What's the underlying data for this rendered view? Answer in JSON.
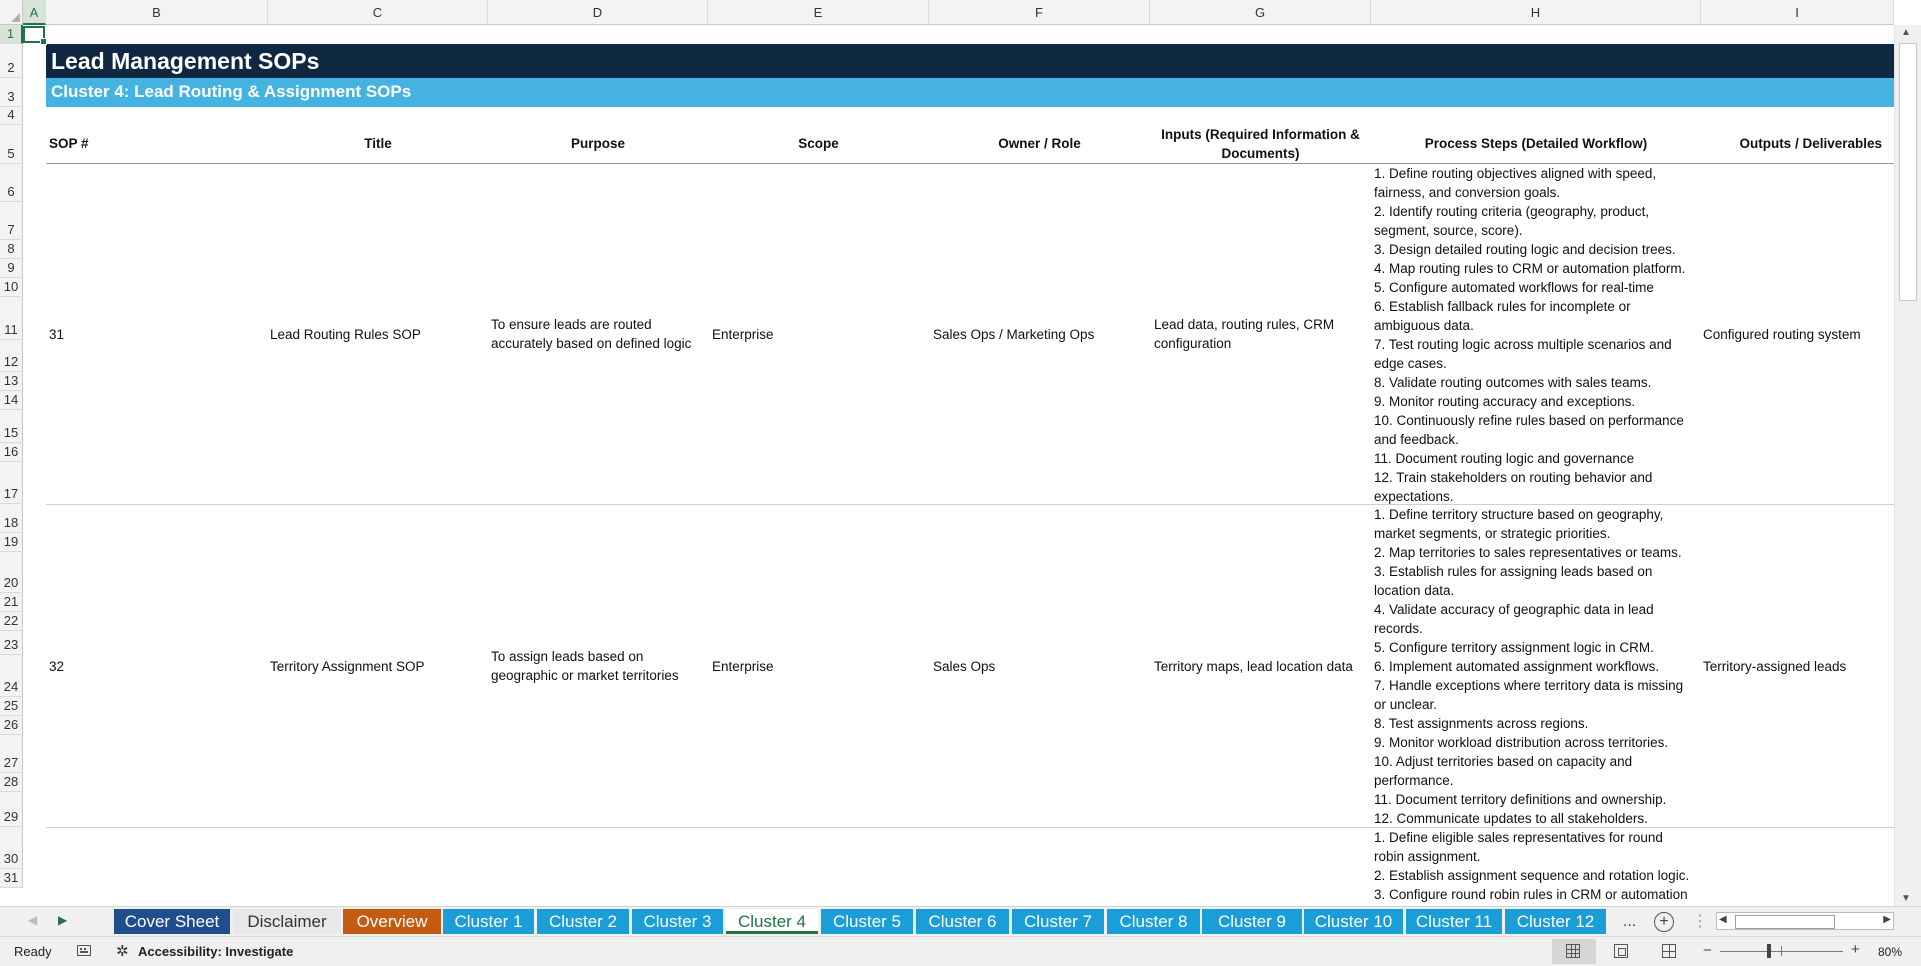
{
  "columns": [
    "A",
    "B",
    "C",
    "D",
    "E",
    "F",
    "G",
    "H",
    "I"
  ],
  "rows": [
    "1",
    "2",
    "3",
    "4",
    "5",
    "6",
    "7",
    "8",
    "9",
    "10",
    "11",
    "12",
    "13",
    "14",
    "15",
    "16",
    "17",
    "18",
    "19",
    "20",
    "21",
    "22",
    "23",
    "24",
    "25",
    "26",
    "27",
    "28",
    "29",
    "30",
    "31"
  ],
  "sheet": {
    "title": "Lead Management SOPs",
    "cluster_title": "Cluster 4: Lead Routing & Assignment SOPs",
    "headers": {
      "sop": "SOP #",
      "title": "Title",
      "purpose": "Purpose",
      "scope": "Scope",
      "owner": "Owner / Role",
      "inputs_1": "Inputs (Required Information &",
      "inputs_2": "Documents)",
      "process": "Process Steps (Detailed Workflow)",
      "outputs": "Outputs / Deliverables"
    },
    "records": [
      {
        "sop": "31",
        "title": "Lead Routing Rules SOP",
        "purpose_1": "To ensure leads are routed",
        "purpose_2": "accurately based on defined logic",
        "scope": "Enterprise",
        "owner": "Sales Ops / Marketing Ops",
        "inputs_1": "Lead data, routing rules, CRM",
        "inputs_2": "configuration",
        "output": "Configured routing system",
        "steps": [
          "1. Define routing objectives aligned with speed,",
          "fairness, and conversion goals.",
          "2. Identify routing criteria (geography, product,",
          "segment, source, score).",
          "3. Design detailed routing logic and decision trees.",
          "4. Map routing rules to CRM or automation platform.",
          "5. Configure automated workflows for real-time",
          "6. Establish fallback rules for incomplete or",
          "ambiguous data.",
          "7. Test routing logic across multiple scenarios and",
          "edge cases.",
          "8. Validate routing outcomes with sales teams.",
          "9. Monitor routing accuracy and exceptions.",
          "10. Continuously refine rules based on performance",
          "and feedback.",
          "11. Document routing logic and governance",
          "12. Train stakeholders on routing behavior and",
          "expectations."
        ]
      },
      {
        "sop": "32",
        "title": "Territory Assignment SOP",
        "purpose_1": "To assign leads based on",
        "purpose_2": "geographic or market territories",
        "scope": "Enterprise",
        "owner": "Sales Ops",
        "inputs_1": "Territory maps, lead location data",
        "inputs_2": "",
        "output": "Territory-assigned leads",
        "steps": [
          "1. Define territory structure based on geography,",
          "market segments, or strategic priorities.",
          "2. Map territories to sales representatives or teams.",
          "3. Establish rules for assigning leads based on",
          "location data.",
          "4. Validate accuracy of geographic data in lead",
          "records.",
          "5. Configure territory assignment logic in CRM.",
          "6. Implement automated assignment workflows.",
          "7. Handle exceptions where territory data is missing",
          "or unclear.",
          "8. Test assignments across regions.",
          "9. Monitor workload distribution across territories.",
          "10. Adjust territories based on capacity and",
          "performance.",
          "11. Document territory definitions and ownership.",
          "12. Communicate updates to all stakeholders."
        ]
      },
      {
        "steps": [
          "1. Define eligible sales representatives for round",
          "robin assignment.",
          "2. Establish assignment sequence and rotation logic.",
          "3. Configure round robin rules in CRM or automation"
        ]
      }
    ]
  },
  "tabs": [
    {
      "label": "Cover Sheet",
      "bg": "#1f4e8c",
      "fg": "#ffffff"
    },
    {
      "label": "Disclaimer",
      "bg": "#e8e8e8",
      "fg": "#333333"
    },
    {
      "label": "Overview",
      "bg": "#c55a11",
      "fg": "#ffffff"
    },
    {
      "label": "Cluster 1",
      "bg": "#1a9ed8",
      "fg": "#ffffff"
    },
    {
      "label": "Cluster 2",
      "bg": "#1a9ed8",
      "fg": "#ffffff"
    },
    {
      "label": "Cluster 3",
      "bg": "#1a9ed8",
      "fg": "#ffffff"
    },
    {
      "label": "Cluster 4",
      "bg": "#ffffff",
      "fg": "#217346"
    },
    {
      "label": "Cluster 5",
      "bg": "#1a9ed8",
      "fg": "#ffffff"
    },
    {
      "label": "Cluster 6",
      "bg": "#1a9ed8",
      "fg": "#ffffff"
    },
    {
      "label": "Cluster 7",
      "bg": "#1a9ed8",
      "fg": "#ffffff"
    },
    {
      "label": "Cluster 8",
      "bg": "#1a9ed8",
      "fg": "#ffffff"
    },
    {
      "label": "Cluster 9",
      "bg": "#1a9ed8",
      "fg": "#ffffff"
    },
    {
      "label": "Cluster 10",
      "bg": "#1a9ed8",
      "fg": "#ffffff"
    },
    {
      "label": "Cluster 11",
      "bg": "#1a9ed8",
      "fg": "#ffffff"
    },
    {
      "label": "Cluster 12",
      "bg": "#1a9ed8",
      "fg": "#ffffff"
    }
  ],
  "tabbar": {
    "more": "..."
  },
  "status": {
    "ready": "Ready",
    "accessibility": "Accessibility: Investigate",
    "zoom": "80%"
  },
  "colors": {
    "title_band": "#0e2841",
    "cluster_band": "#45b3e1",
    "accent": "#217346"
  },
  "icons": [
    "macro-record-icon",
    "accessibility-icon",
    "normal-view-icon",
    "page-layout-icon",
    "page-break-icon",
    "add-sheet-icon"
  ]
}
